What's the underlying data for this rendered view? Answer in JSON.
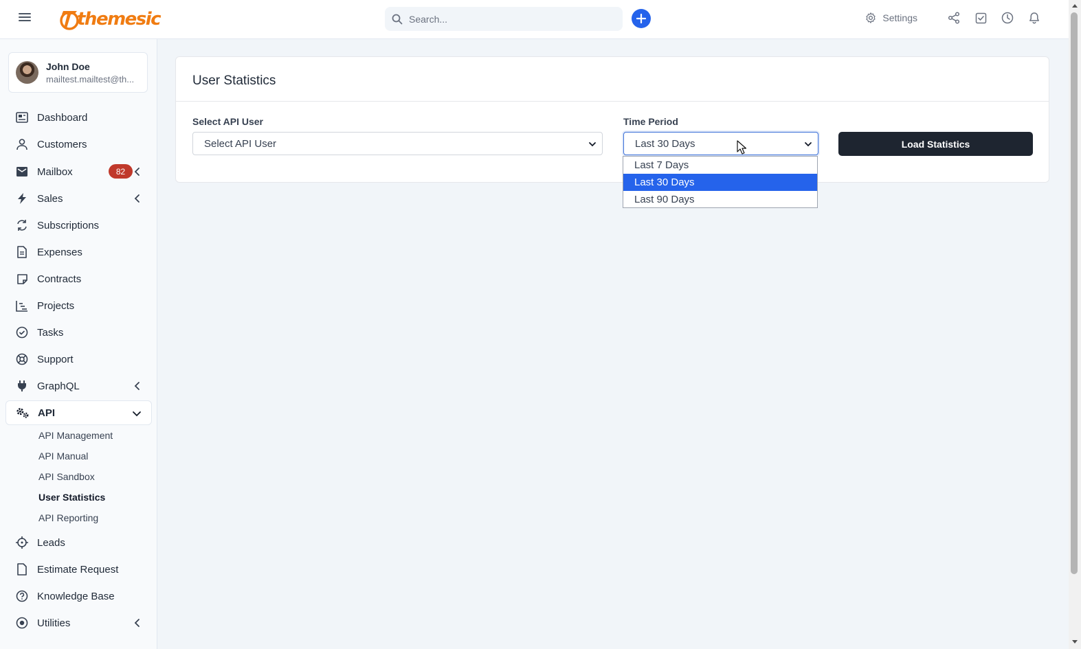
{
  "header": {
    "brand": "themesic",
    "search_placeholder": "Search...",
    "settings_label": "Settings",
    "icons": [
      "menu-icon",
      "search-icon",
      "plus-icon",
      "gear-icon",
      "share-icon",
      "checkbox-icon",
      "clock-icon",
      "bell-icon"
    ]
  },
  "user": {
    "name": "John Doe",
    "email": "mailtest.mailtest@th..."
  },
  "sidebar": {
    "items": [
      {
        "label": "Dashboard",
        "icon": "dashboard-icon"
      },
      {
        "label": "Customers",
        "icon": "user-icon"
      },
      {
        "label": "Mailbox",
        "icon": "envelope-icon",
        "badge": "82"
      },
      {
        "label": "Sales",
        "icon": "bolt-icon"
      },
      {
        "label": "Subscriptions",
        "icon": "refresh-icon"
      },
      {
        "label": "Expenses",
        "icon": "document-icon"
      },
      {
        "label": "Contracts",
        "icon": "note-icon"
      },
      {
        "label": "Projects",
        "icon": "chart-icon"
      },
      {
        "label": "Tasks",
        "icon": "check-circle-icon"
      },
      {
        "label": "Support",
        "icon": "lifebuoy-icon"
      },
      {
        "label": "GraphQL",
        "icon": "plug-icon"
      },
      {
        "label": "API",
        "icon": "gears-icon"
      },
      {
        "label": "Leads",
        "icon": "crosshair-icon"
      },
      {
        "label": "Estimate Request",
        "icon": "file-icon"
      },
      {
        "label": "Knowledge Base",
        "icon": "question-circle-icon"
      },
      {
        "label": "Utilities",
        "icon": "dot-circle-icon"
      }
    ],
    "api_sub_items": [
      "API Management",
      "API Manual",
      "API Sandbox",
      "User Statistics",
      "API Reporting"
    ]
  },
  "main": {
    "card_title": "User Statistics",
    "api_user_label": "Select API User",
    "api_user_value": "Select API User",
    "time_period_label": "Time Period",
    "time_period_value": "Last 30 Days",
    "time_period_options": [
      "Last 7 Days",
      "Last 30 Days",
      "Last 90 Days"
    ],
    "selected_option": "Last 30 Days",
    "load_button": "Load Statistics"
  },
  "colors": {
    "accent": "#2563eb",
    "brand_orange": "#f07c12",
    "badge_red": "#c0392b",
    "button_dark": "#1e2530"
  }
}
